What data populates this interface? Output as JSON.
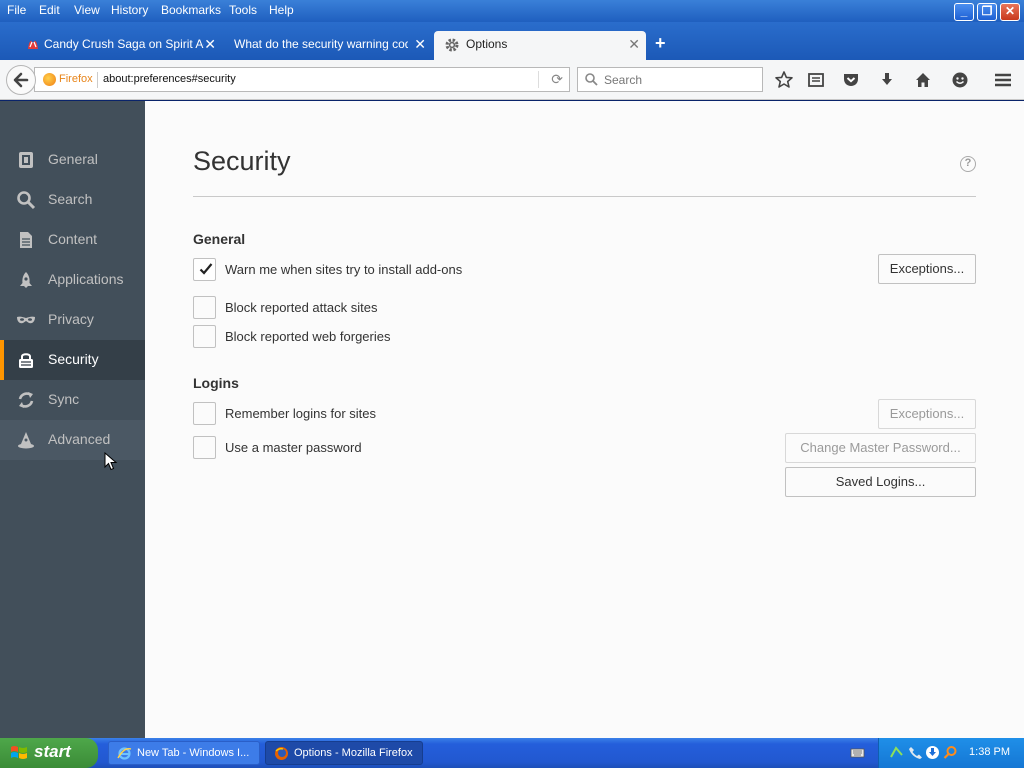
{
  "menubar": {
    "items": [
      {
        "label": "File"
      },
      {
        "label": "Edit"
      },
      {
        "label": "View"
      },
      {
        "label": "History"
      },
      {
        "label": "Bookmarks"
      },
      {
        "label": "Tools"
      },
      {
        "label": "Help"
      }
    ],
    "window_controls": {
      "minimize": "_",
      "restore": "❐",
      "close": "✕"
    }
  },
  "tabs": [
    {
      "label": "Candy Crush Saga on Spirit Ac...",
      "icon": "candy-icon",
      "close": "✕",
      "active": false
    },
    {
      "label": "What do the security warning code...",
      "icon": "page-icon",
      "close": "✕",
      "active": false
    },
    {
      "label": "Options",
      "icon": "gear-icon",
      "close": "✕",
      "active": true
    }
  ],
  "new_tab_label": "+",
  "navbar": {
    "identity_label": "Firefox",
    "url": "about:preferences#security",
    "reload_glyph": "⟳",
    "search_placeholder": "Search"
  },
  "sidebar": {
    "items": [
      {
        "label": "General",
        "icon": "general-icon"
      },
      {
        "label": "Search",
        "icon": "search-icon"
      },
      {
        "label": "Content",
        "icon": "content-icon"
      },
      {
        "label": "Applications",
        "icon": "applications-icon"
      },
      {
        "label": "Privacy",
        "icon": "privacy-mask-icon"
      },
      {
        "label": "Security",
        "icon": "security-lock-icon",
        "selected": true
      },
      {
        "label": "Sync",
        "icon": "sync-icon"
      },
      {
        "label": "Advanced",
        "icon": "advanced-wizard-icon"
      }
    ]
  },
  "main": {
    "title": "Security",
    "help_glyph": "?",
    "general": {
      "heading": "General",
      "warn_addons": {
        "label": "Warn me when sites try to install add-ons",
        "checked": true
      },
      "exceptions_button": "Exceptions...",
      "block_attack": {
        "label": "Block reported attack sites",
        "checked": false
      },
      "block_forgeries": {
        "label": "Block reported web forgeries",
        "checked": false
      }
    },
    "logins": {
      "heading": "Logins",
      "remember_logins": {
        "label": "Remember logins for sites",
        "checked": false
      },
      "exceptions_button": "Exceptions...",
      "master_password": {
        "label": "Use a master password",
        "checked": false
      },
      "change_master_button": "Change Master Password...",
      "saved_logins_button": "Saved Logins..."
    }
  },
  "taskbar": {
    "start_label": "start",
    "tasks": [
      {
        "label": "New Tab - Windows I...",
        "icon": "ie-icon"
      },
      {
        "label": "Options - Mozilla Firefox",
        "icon": "firefox-icon",
        "active": true
      }
    ],
    "clock": "1:38 PM"
  },
  "colors": {
    "sidebar_bg": "#424f5a",
    "sidebar_selected_bg": "#343f48",
    "sidebar_accent": "#ff9500",
    "content_bg": "#fbfbfb",
    "titlebar_blue": "#1f5fbf"
  }
}
